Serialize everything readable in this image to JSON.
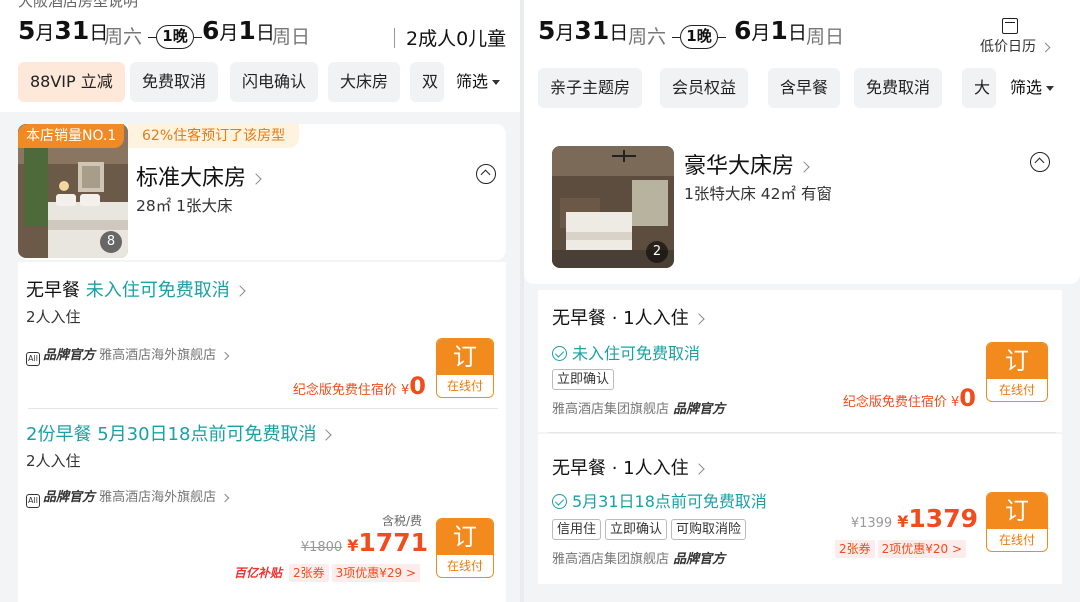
{
  "left": {
    "header": {
      "cut_text": "大阪酒店房型说明",
      "checkin_day": "5",
      "checkin_month_suffix": "月",
      "checkin_date": "31",
      "checkin_date_suffix": "日",
      "checkin_weekday": "周六",
      "nights": "1晚",
      "checkout_day": "6",
      "checkout_month_suffix": "月",
      "checkout_date": "1",
      "checkout_date_suffix": "日",
      "checkout_weekday": "周日",
      "guests": "2成人0儿童"
    },
    "chips": [
      "88VIP 立减",
      "免费取消",
      "闪电确认",
      "大床房",
      "双"
    ],
    "filter_label": "筛选",
    "room": {
      "badge_sales": "本店销量NO.1",
      "badge_booked": "62%住客预订了该房型",
      "title": "标准大床房",
      "sub": "28㎡  1张大床",
      "image_count": "8"
    },
    "offers": [
      {
        "meal": "无早餐",
        "cancel": "未入住可免费取消",
        "occupancy": "2人入住",
        "seller_brand": "品牌官方",
        "seller_name": "雅高酒店海外旗舰店",
        "promo_text": "纪念版免费住宿价",
        "promo_yen": "¥",
        "promo_price": "0",
        "book_label": "订",
        "pay_label": "在线付"
      },
      {
        "meal": "2份早餐",
        "cancel": "5月30日18点前可免费取消",
        "occupancy": "2人入住",
        "seller_brand": "品牌官方",
        "seller_name": "雅高酒店海外旗舰店",
        "tax_note": "含税/费",
        "orig_price": "¥1800",
        "yen": "¥",
        "price": "1771",
        "subsidy": "百亿补贴",
        "coupon": "2张券",
        "discount": "3项优惠¥29 >",
        "book_label": "订",
        "pay_label": "在线付"
      }
    ]
  },
  "right": {
    "header": {
      "checkin_day": "5",
      "checkin_month_suffix": "月",
      "checkin_date": "31",
      "checkin_date_suffix": "日",
      "checkin_weekday": "周六",
      "nights": "1晚",
      "checkout_day": "6",
      "checkout_month_suffix": "月",
      "checkout_date": "1",
      "checkout_date_suffix": "日",
      "checkout_weekday": "周日",
      "calendar_label": "低价日历"
    },
    "chips": [
      "亲子主题房",
      "会员权益",
      "含早餐",
      "免费取消",
      "大"
    ],
    "filter_label": "筛选",
    "room": {
      "title": "豪华大床房",
      "sub": "1张特大床  42㎡  有窗",
      "image_count": "2"
    },
    "offers": [
      {
        "meal": "无早餐 · 1人入住",
        "cancel": "未入住可免费取消",
        "tags": [
          "立即确认"
        ],
        "seller_name": "雅高酒店集团旗舰店",
        "seller_brand": "品牌官方",
        "promo_text": "纪念版免费住宿价",
        "promo_yen": "¥",
        "promo_price": "0",
        "book_label": "订",
        "pay_label": "在线付"
      },
      {
        "meal": "无早餐 · 1人入住",
        "cancel": "5月31日18点前可免费取消",
        "tags": [
          "信用住",
          "立即确认",
          "可购取消险"
        ],
        "seller_name": "雅高酒店集团旗舰店",
        "seller_brand": "品牌官方",
        "orig_price": "¥1399",
        "yen": "¥",
        "price": "1379",
        "coupon": "2张券",
        "discount": "2项优惠¥20 >",
        "book_label": "订",
        "pay_label": "在线付"
      }
    ]
  },
  "colors": {
    "accent_orange": "#f28a1e",
    "price_red": "#f24c1d",
    "teal": "#1aa1a6"
  }
}
